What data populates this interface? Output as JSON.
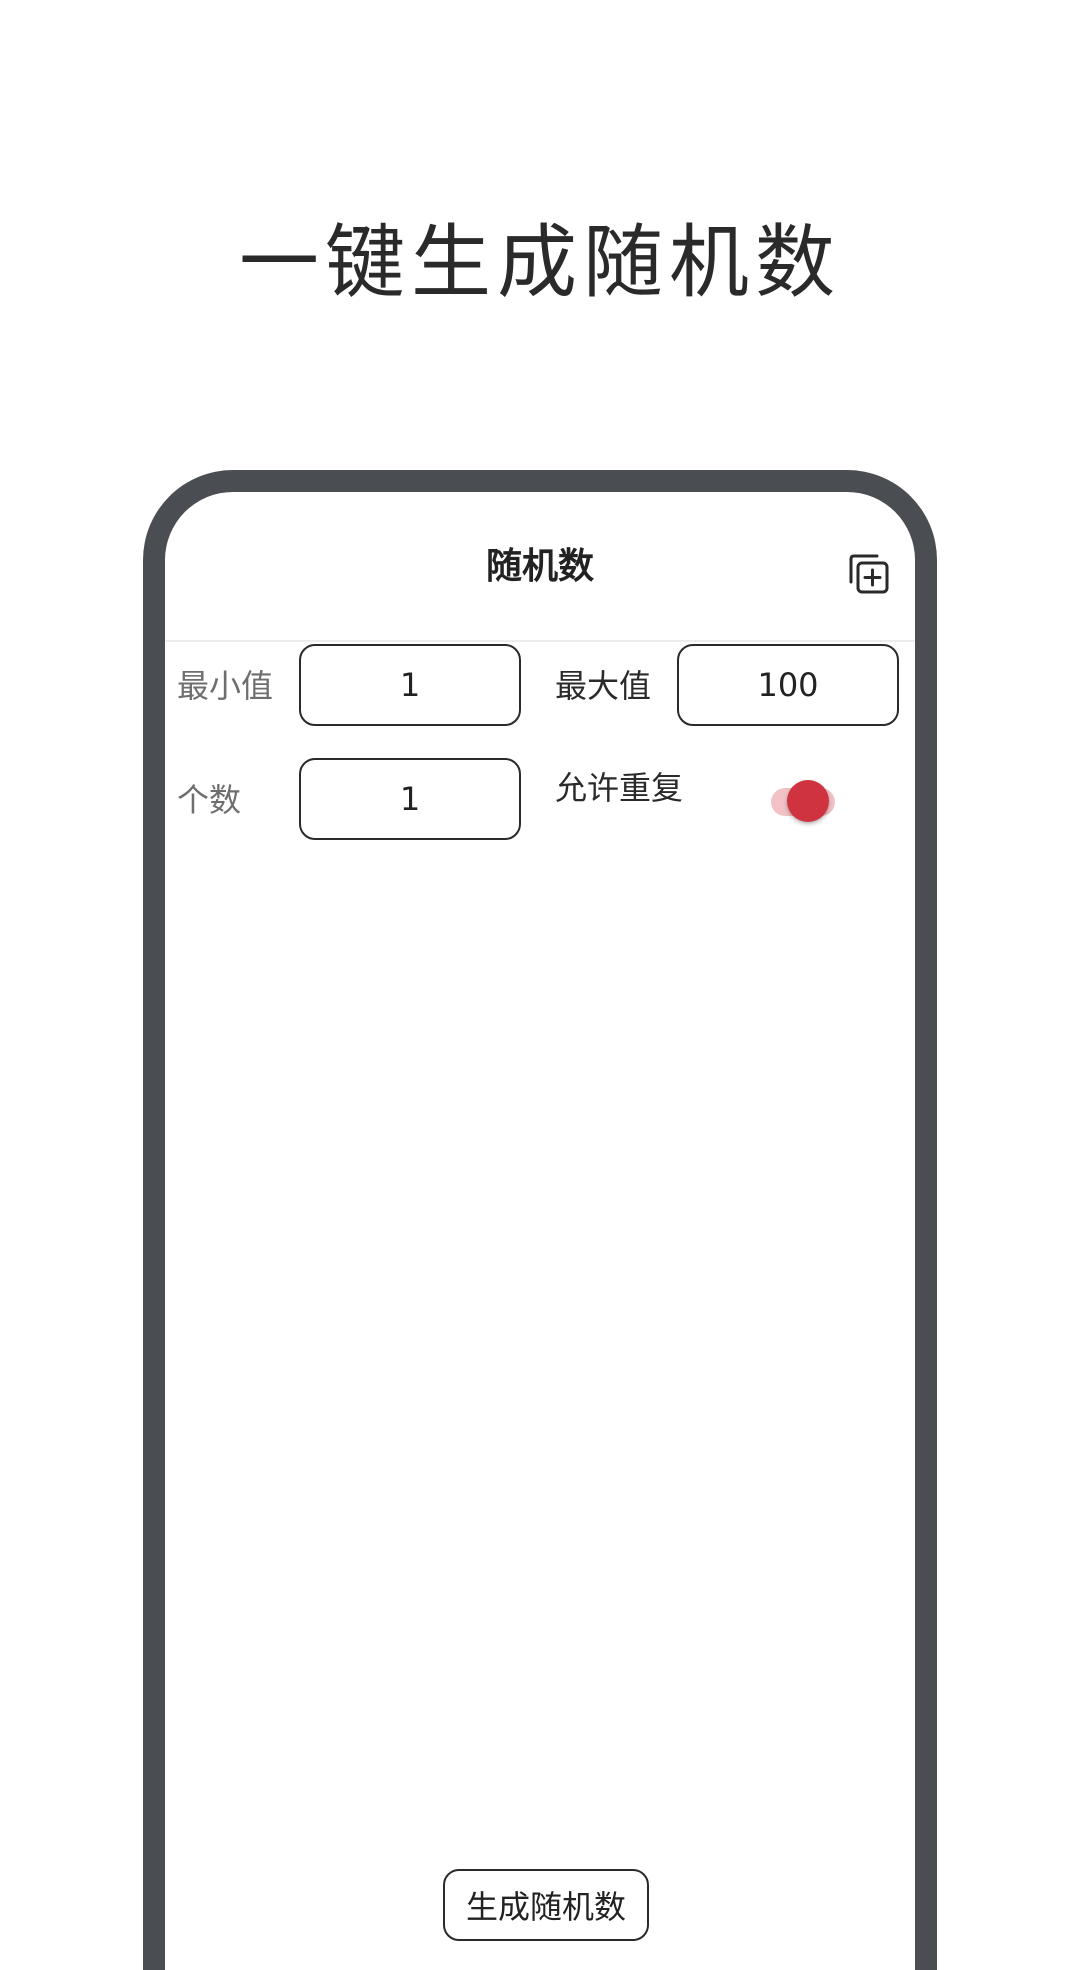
{
  "promo": {
    "title": "一键生成随机数"
  },
  "app": {
    "title": "随机数",
    "header_icon": "add-copy-icon"
  },
  "form": {
    "min_label": "最小值",
    "min_value": "1",
    "max_label": "最大值",
    "max_value": "100",
    "count_label": "个数",
    "count_value": "1",
    "allow_repeat_label": "允许重复",
    "allow_repeat_enabled": true
  },
  "actions": {
    "generate_label": "生成随机数"
  },
  "colors": {
    "frame": "#4a4d52",
    "accent": "#cf3340",
    "toggle_track": "#f2c2c6"
  }
}
